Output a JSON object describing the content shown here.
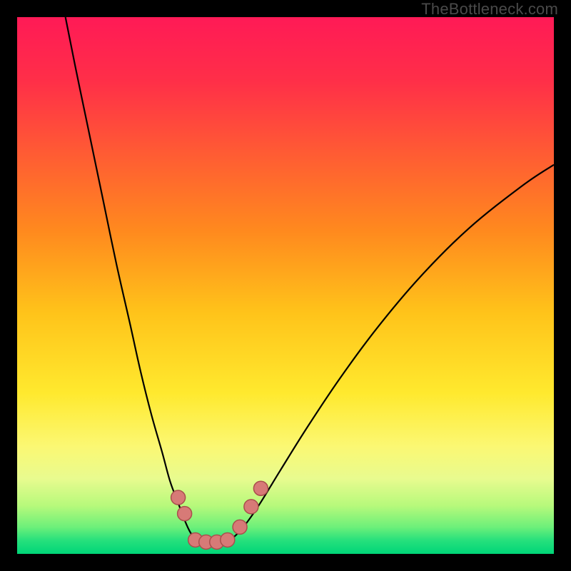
{
  "watermark": "TheBottleneck.com",
  "chart_data": {
    "type": "line",
    "title": "",
    "xlabel": "",
    "ylabel": "",
    "xlim": [
      0,
      100
    ],
    "ylim": [
      0,
      100
    ],
    "grid": false,
    "legend": false,
    "background_gradient_stops": [
      {
        "offset": 0.0,
        "color": "#ff1a56"
      },
      {
        "offset": 0.12,
        "color": "#ff2f48"
      },
      {
        "offset": 0.25,
        "color": "#ff5a34"
      },
      {
        "offset": 0.4,
        "color": "#ff8a1e"
      },
      {
        "offset": 0.55,
        "color": "#ffc31a"
      },
      {
        "offset": 0.7,
        "color": "#ffe92e"
      },
      {
        "offset": 0.8,
        "color": "#fbf873"
      },
      {
        "offset": 0.86,
        "color": "#e8fb8f"
      },
      {
        "offset": 0.91,
        "color": "#b7f97b"
      },
      {
        "offset": 0.95,
        "color": "#6df07a"
      },
      {
        "offset": 0.975,
        "color": "#26e07c"
      },
      {
        "offset": 1.0,
        "color": "#00d578"
      }
    ],
    "series": [
      {
        "name": "left-curve",
        "color": "#000000",
        "x": [
          9.0,
          11.0,
          13.5,
          16.0,
          18.5,
          21.0,
          23.0,
          25.0,
          27.0,
          28.5,
          30.0,
          31.0,
          32.0,
          33.0
        ],
        "y": [
          100.0,
          90.0,
          78.0,
          66.0,
          54.0,
          43.0,
          34.0,
          26.0,
          19.0,
          13.5,
          9.5,
          6.8,
          4.5,
          2.8
        ]
      },
      {
        "name": "right-curve",
        "color": "#000000",
        "x": [
          40.0,
          42.0,
          45.0,
          49.0,
          54.0,
          60.0,
          67.0,
          75.0,
          84.0,
          94.0,
          100.0
        ],
        "y": [
          2.8,
          4.8,
          9.0,
          15.5,
          23.5,
          32.5,
          42.0,
          51.5,
          60.5,
          68.5,
          72.5
        ]
      },
      {
        "name": "floor",
        "color": "#000000",
        "x": [
          33.0,
          34.5,
          36.5,
          38.5,
          40.0
        ],
        "y": [
          2.8,
          2.1,
          1.9,
          2.1,
          2.8
        ]
      }
    ],
    "markers": [
      {
        "name": "left-top-marker",
        "x": 30.0,
        "y": 10.5
      },
      {
        "name": "left-mid-marker",
        "x": 31.2,
        "y": 7.5
      },
      {
        "name": "floor-a-marker",
        "x": 33.2,
        "y": 2.6
      },
      {
        "name": "floor-b-marker",
        "x": 35.2,
        "y": 2.2
      },
      {
        "name": "floor-c-marker",
        "x": 37.2,
        "y": 2.2
      },
      {
        "name": "floor-d-marker",
        "x": 39.2,
        "y": 2.6
      },
      {
        "name": "right-low-marker",
        "x": 41.5,
        "y": 5.0
      },
      {
        "name": "right-mid-marker",
        "x": 43.6,
        "y": 8.8
      },
      {
        "name": "right-high-marker",
        "x": 45.4,
        "y": 12.2
      }
    ],
    "marker_style": {
      "radius_px": 10,
      "fill": "#d77a77",
      "stroke": "#a94f4c",
      "stroke_width": 1.5
    },
    "curve_stroke_width": 2.2
  }
}
